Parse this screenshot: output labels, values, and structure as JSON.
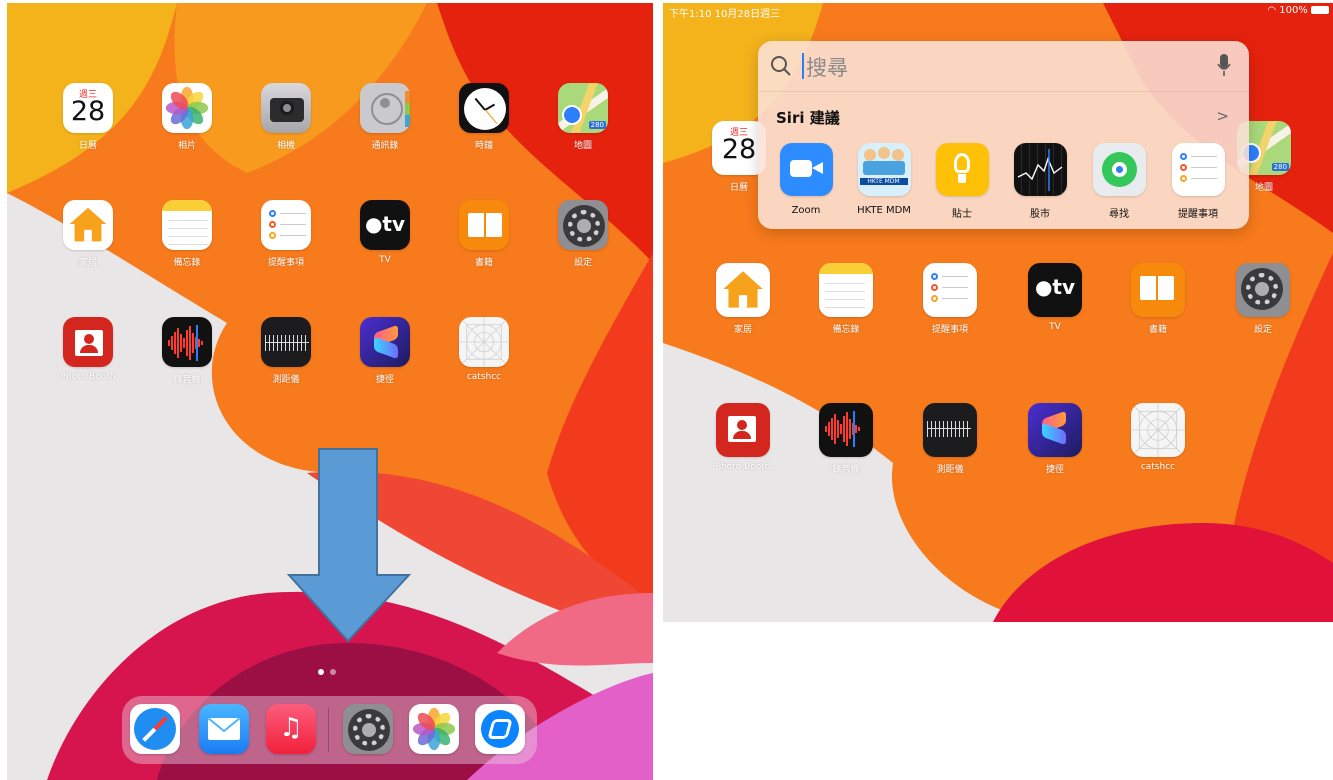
{
  "left": {
    "home_icons": [
      {
        "label": "日曆",
        "icon": "calendar-icon",
        "day": "28",
        "weekday": "週三"
      },
      {
        "label": "相片",
        "icon": "photos-icon"
      },
      {
        "label": "相機",
        "icon": "camera-icon"
      },
      {
        "label": "通訊錄",
        "icon": "contacts-icon"
      },
      {
        "label": "時鐘",
        "icon": "clock-icon"
      },
      {
        "label": "地圖",
        "icon": "maps-icon",
        "badge": "280"
      },
      {
        "label": "家居",
        "icon": "home-icon"
      },
      {
        "label": "備忘錄",
        "icon": "notes-icon"
      },
      {
        "label": "提醒事項",
        "icon": "reminders-icon"
      },
      {
        "label": "TV",
        "icon": "apple-tv-icon",
        "text": "tv"
      },
      {
        "label": "書籍",
        "icon": "books-icon"
      },
      {
        "label": "設定",
        "icon": "settings-icon"
      },
      {
        "label": "Photo Booth",
        "icon": "photo-booth-icon"
      },
      {
        "label": "錄音機",
        "icon": "voice-memos-icon"
      },
      {
        "label": "測距儀",
        "icon": "measure-icon"
      },
      {
        "label": "捷徑",
        "icon": "shortcuts-icon"
      },
      {
        "label": "catshcc",
        "icon": "placeholder-app-icon"
      }
    ],
    "dock": [
      "safari-icon",
      "mail-icon",
      "music-icon",
      "settings-icon",
      "photos-icon",
      "mdm-app-icon"
    ],
    "page_dots": 2,
    "arrow_color": "#5b9bd5"
  },
  "right": {
    "status_time": "下午1:10  10月28日週三",
    "status_battery": "100%",
    "search_placeholder": "搜尋",
    "siri_title": "Siri 建議",
    "siri_chevron": ">",
    "suggestions": [
      {
        "label": "Zoom",
        "icon": "zoom-icon"
      },
      {
        "label": "HKTE MDM",
        "icon": "hkte-mdm-icon",
        "text": "HKTE MDM"
      },
      {
        "label": "貼士",
        "icon": "tips-icon"
      },
      {
        "label": "股市",
        "icon": "stocks-icon"
      },
      {
        "label": "尋找",
        "icon": "find-my-icon"
      },
      {
        "label": "提醒事項",
        "icon": "reminders-icon"
      }
    ],
    "home_icons": [
      {
        "label": "日曆",
        "day": "28",
        "weekday": "週三"
      },
      {
        "label": "地圖",
        "badge": "280"
      },
      {
        "label": "家居"
      },
      {
        "label": "備忘錄"
      },
      {
        "label": "提醒事項"
      },
      {
        "label": "TV",
        "text": "tv"
      },
      {
        "label": "書籍"
      },
      {
        "label": "設定"
      },
      {
        "label": "Photo Booth"
      },
      {
        "label": "錄音機"
      },
      {
        "label": "測距儀"
      },
      {
        "label": "捷徑"
      },
      {
        "label": "catshcc"
      }
    ]
  }
}
